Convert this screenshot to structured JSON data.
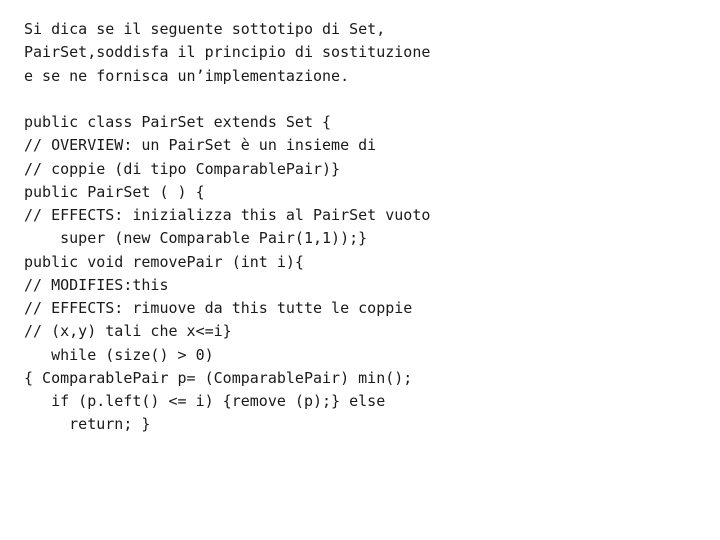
{
  "content": {
    "lines": [
      "Si dica se il seguente sottotipo di Set,",
      "PairSet,soddisfa il principio di sostituzione",
      "e se ne fornisca un’implementazione.",
      "",
      "public class PairSet extends Set {",
      "// OVERVIEW: un PairSet è un insieme di",
      "// coppie (di tipo ComparablePair)}",
      "public PairSet ( ) {",
      "// EFFECTS: inizializza this al PairSet vuoto",
      "    super (new Comparable Pair(1,1));}",
      "public void removePair (int i){",
      "// MODIFIES:this",
      "// EFFECTS: rimuove da this tutte le coppie",
      "// (x,y) tali che x<=i}",
      "   while (size() > 0)",
      "{ ComparablePair p= (ComparablePair) min();",
      "   if (p.left() <= i) {remove (p);} else",
      "     return; }"
    ]
  }
}
